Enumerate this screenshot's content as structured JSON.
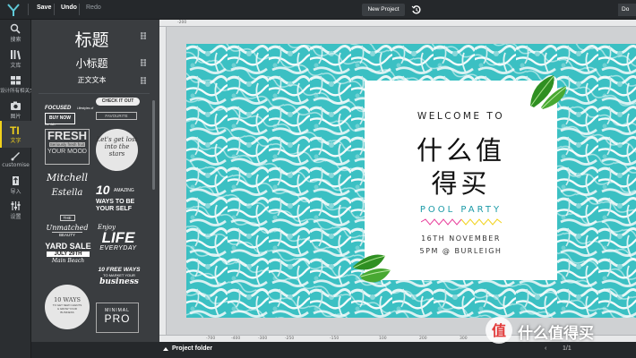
{
  "toolbar": {
    "save": "Save",
    "undo": "Undo",
    "redo": "Redo",
    "new_project": "New Project",
    "right_cut": "Do"
  },
  "nav": [
    {
      "label": "搜索",
      "icon": "search-icon"
    },
    {
      "label": "文库",
      "icon": "library-icon"
    },
    {
      "label": "设计所有相关文字",
      "icon": "layouts-icon"
    },
    {
      "label": "图片",
      "icon": "camera-icon"
    },
    {
      "label": "文字",
      "icon": "text-icon"
    },
    {
      "label": "customise",
      "icon": "brush-icon"
    },
    {
      "label": "导入",
      "icon": "upload-icon"
    },
    {
      "label": "设置",
      "icon": "sliders-icon"
    }
  ],
  "panel": {
    "heading": "标题",
    "subheading": "小标题",
    "body": "正文文本",
    "templates": {
      "focused": "FOCUSED",
      "focused_sub": "Lifestyles of the rich",
      "check_it_out": "CHECK IT OUT",
      "buy_now": "BUY NOW",
      "favourite": "FAVOURITE",
      "fresh": "FRESH",
      "fresh_sub": "Seriously fresh fruit",
      "your_mood": "YOUR MOOD",
      "lets_get_lost": "Let's get lost into the stars",
      "mitchell": "Mitchell",
      "estella": "Estella",
      "the": "THE",
      "unmatched": "Unmatched",
      "beauty": "BEAUTY",
      "amazing_10": "10",
      "amazing": "AMAZING",
      "ways_to": "WAYS TO BE",
      "your_self": "YOUR SELF",
      "yard_sale": "YARD SALE",
      "july": "JULY 29TH",
      "main_beach": "Main Beach",
      "enjoy": "Enjoy",
      "life": "LIFE",
      "everyday": "EVERYDAY",
      "free_ways": "10 FREE WAYS",
      "to_market": "TO MARKET YOUR",
      "business": "business",
      "ten_ways": "10 WAYS",
      "ten_ways_sub": "TO GET NEW CLIENTS & GROW YOUR BUSINESS",
      "minimal": "MINIMAL",
      "pro": "PRO"
    }
  },
  "rulers": {
    "top": [
      "-200",
      "|100",
      "|0",
      "|100",
      "|200",
      "|300",
      "|400",
      "|500",
      "|600",
      "|700"
    ],
    "bottom": [
      "-700",
      "-500",
      "-400",
      "-300",
      "-250",
      "-150",
      "-100",
      "50",
      "100",
      "150",
      "200",
      "250",
      "300",
      "350",
      "400",
      "450",
      "500",
      "550",
      "600"
    ]
  },
  "card": {
    "welcome": "WELCOME TO",
    "cn_line1": "什么值",
    "cn_line2": "得买",
    "pool_party": "POOL PARTY",
    "date": "16TH NOVEMBER",
    "time": "5PM @ BURLEIGH"
  },
  "bottom": {
    "folder": "Project folder",
    "page": "1/1"
  },
  "watermark": "值 什么值得买",
  "colors": {
    "accent": "#f2d21b",
    "pool": "#1b9aa7",
    "leaf": "#3a9a2a"
  }
}
